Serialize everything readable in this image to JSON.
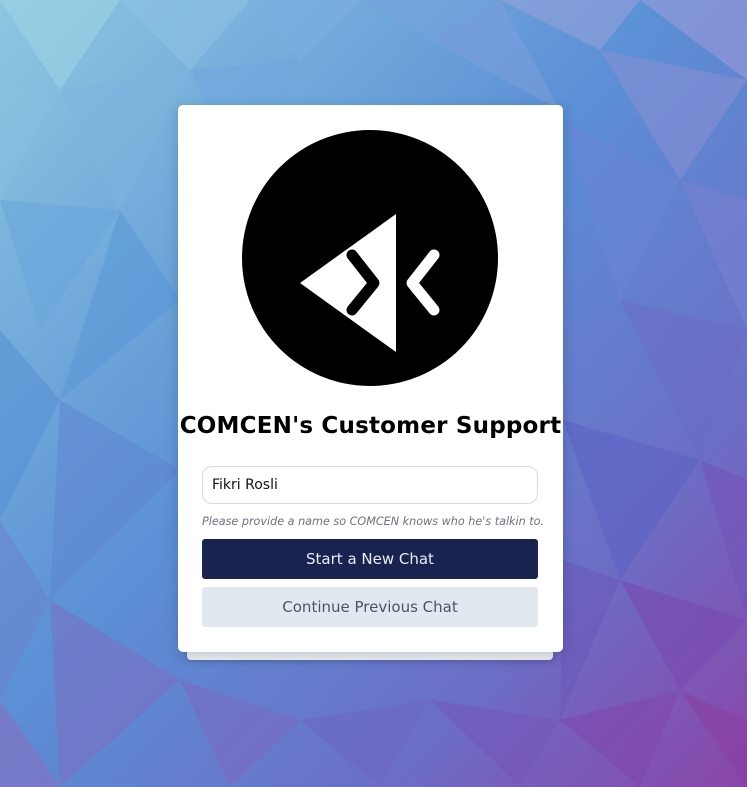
{
  "app": {
    "title": "COMCEN's Customer Support"
  },
  "logo": {
    "icon": "comcen-chevrons-logo-icon"
  },
  "form": {
    "name_value": "Fikri Rosli",
    "hint": "Please provide a name so COMCEN knows who he's talkin to."
  },
  "buttons": {
    "start_label": "Start a New Chat",
    "continue_label": "Continue Previous Chat"
  },
  "colors": {
    "primary_button": "#18244f",
    "secondary_button": "#e2e8f0"
  }
}
